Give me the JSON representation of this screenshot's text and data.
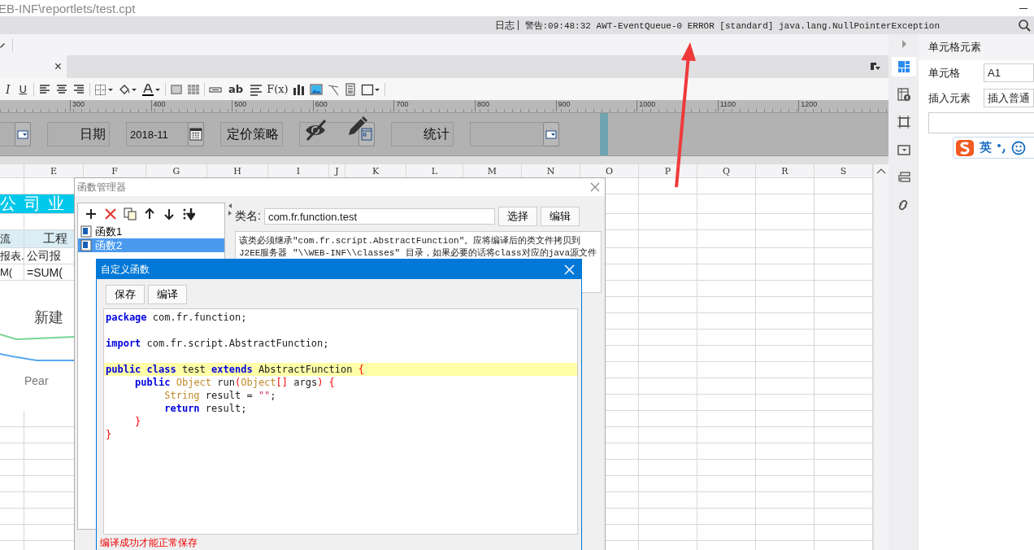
{
  "window": {
    "title": "EB-INF\\reportlets/test.cpt"
  },
  "log_bar": {
    "label": "日志",
    "message": "警告:09:48:32 AWT-EventQueue-0 ERROR [standard] java.lang.NullPointerException"
  },
  "document_tab": {
    "close": "×"
  },
  "format_toolbar": {
    "italic": "I",
    "underline": "U",
    "text": "ab",
    "formula": "F(x)"
  },
  "ruler": {
    "labels": [
      "300",
      "400",
      "500",
      "600",
      "700",
      "800",
      "900",
      "1000",
      "1100",
      "1200"
    ]
  },
  "parameter_panel": {
    "widgets": [
      {
        "kind": "combo"
      },
      {
        "kind": "label",
        "text": "日期"
      },
      {
        "kind": "date",
        "value": "2018-11"
      },
      {
        "kind": "label",
        "text": "定价策略"
      },
      {
        "kind": "hidden"
      },
      {
        "kind": "label",
        "text": "统计"
      },
      {
        "kind": "combo"
      }
    ]
  },
  "spreadsheet": {
    "columns": [
      "E",
      "F",
      "G",
      "H",
      "I",
      "J",
      "K",
      "L",
      "M",
      "N",
      "O",
      "P",
      "Q",
      "R",
      "S"
    ],
    "rows": [
      {
        "kind": "empty"
      },
      {
        "kind": "banner",
        "cells": [
          "公 司 业"
        ]
      },
      {
        "kind": "empty"
      },
      {
        "kind": "header",
        "cells": [
          "流",
          "工程"
        ]
      },
      {
        "kind": "data",
        "cells": [
          "报表.",
          "公司报"
        ]
      },
      {
        "kind": "data",
        "cells": [
          "M(",
          "=SUM("
        ]
      }
    ],
    "chart": {
      "title": "新建",
      "category_label": "Pear"
    }
  },
  "right_panel": {
    "title": "单元格元素",
    "tool_tabs": [
      {
        "selected": true
      },
      {
        "selected": false
      },
      {
        "selected": false
      },
      {
        "selected": false
      },
      {
        "selected": false
      },
      {
        "selected": false
      }
    ],
    "fields": [
      {
        "label": "单元格",
        "value": "A1"
      },
      {
        "label": "插入元素",
        "value": "插入普通"
      }
    ],
    "ime": {
      "mode": "英"
    }
  },
  "function_manager": {
    "title": "函数管理器",
    "functions": [
      {
        "name": "函数1",
        "selected": false
      },
      {
        "name": "函数2",
        "selected": true
      }
    ],
    "class_label": "类名:",
    "class_name": "com.fr.function.test",
    "buttons": [
      "选择",
      "编辑"
    ],
    "description": [
      "该类必须继承\"com.fr.script.AbstractFunction\"。应将编译后的类文件拷贝到",
      "J2EE服务器 \"\\\\WEB-INF\\\\classes\" 目录，如果必要的话将class对应的java源文件"
    ]
  },
  "editor": {
    "title": "自定义函数",
    "buttons": [
      "保存",
      "编译"
    ],
    "lines": [
      {
        "highlighted": false,
        "tokens": [
          {
            "kind": "keyword",
            "text": "package"
          },
          {
            "kind": "plain",
            "text": " com.fr.function;"
          }
        ]
      },
      {
        "highlighted": false
      },
      {
        "highlighted": false,
        "tokens": [
          {
            "kind": "keyword",
            "text": "import"
          },
          {
            "kind": "plain",
            "text": " com.fr.script.AbstractFunction;"
          }
        ]
      },
      {
        "highlighted": false
      },
      {
        "highlighted": true,
        "tokens": [
          {
            "kind": "keyword",
            "text": "public"
          },
          {
            "kind": "keyword",
            "text": " class"
          },
          {
            "kind": "plain",
            "text": " test "
          },
          {
            "kind": "keyword",
            "text": "extends"
          },
          {
            "kind": "plain",
            "text": " AbstractFunction "
          },
          {
            "kind": "brace",
            "text": "{"
          }
        ]
      },
      {
        "highlighted": false,
        "tokens": [
          {
            "kind": "keyword",
            "text": "     public"
          },
          {
            "kind": "type",
            "text": " Object"
          },
          {
            "kind": "plain",
            "text": " run"
          },
          {
            "kind": "brace",
            "text": "("
          },
          {
            "kind": "type",
            "text": "Object"
          },
          {
            "kind": "brace",
            "text": "[]"
          },
          {
            "kind": "plain",
            "text": " args"
          },
          {
            "kind": "brace",
            "text": ")"
          },
          {
            "kind": "brace",
            "text": " {"
          }
        ]
      },
      {
        "highlighted": false,
        "tokens": [
          {
            "kind": "type",
            "text": "          String"
          },
          {
            "kind": "plain",
            "text": " result = "
          },
          {
            "kind": "string",
            "text": "\"\""
          },
          {
            "kind": "plain",
            "text": ";"
          }
        ]
      },
      {
        "highlighted": false,
        "tokens": [
          {
            "kind": "keyword",
            "text": "          return"
          },
          {
            "kind": "plain",
            "text": " result;"
          }
        ]
      },
      {
        "highlighted": false,
        "tokens": [
          {
            "kind": "brace",
            "text": "     }"
          }
        ]
      },
      {
        "highlighted": false,
        "tokens": [
          {
            "kind": "brace",
            "text": "}"
          }
        ]
      }
    ],
    "status": "编译成功才能正常保存"
  }
}
